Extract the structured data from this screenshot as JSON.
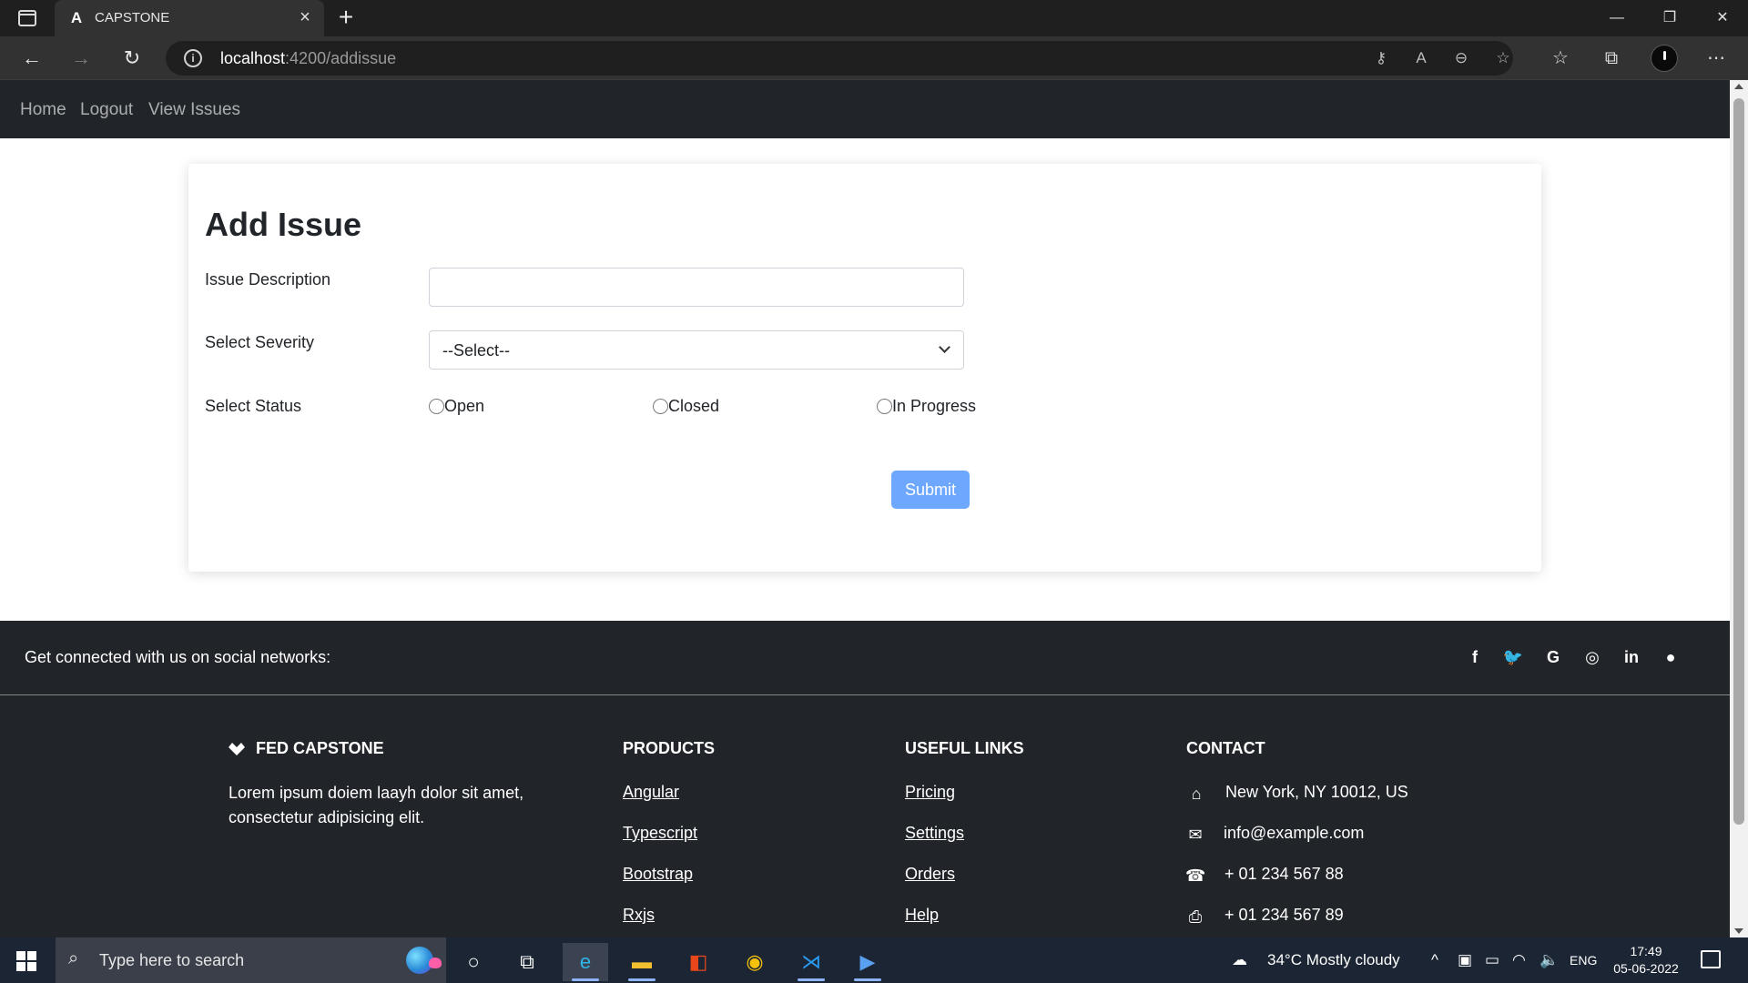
{
  "browser": {
    "tab_title": "CAPSTONE",
    "tab_favicon": "A",
    "url_host": "localhost",
    "url_rest": ":4200/addissue"
  },
  "nav": {
    "items": [
      "Home",
      "Logout",
      "View Issues"
    ]
  },
  "form": {
    "title": "Add Issue",
    "description_label": "Issue Description",
    "description_value": "",
    "severity_label": "Select Severity",
    "severity_selected": "--Select--",
    "status_label": "Select Status",
    "status_options": [
      "Open",
      "Closed",
      "In Progress"
    ],
    "submit_label": "Submit"
  },
  "footer": {
    "social_text": "Get connected with us on social networks:",
    "social_icons": [
      "facebook-icon",
      "twitter-icon",
      "google-icon",
      "instagram-icon",
      "linkedin-icon",
      "github-icon"
    ],
    "brand": "FED CAPSTONE",
    "brand_desc": "Lorem ipsum doiem laayh dolor sit amet, consectetur adipisicing elit.",
    "products_title": "PRODUCTS",
    "products": [
      "Angular",
      "Typescript",
      "Bootstrap",
      "Rxjs"
    ],
    "useful_title": "USEFUL LINKS",
    "useful": [
      "Pricing",
      "Settings",
      "Orders",
      "Help"
    ],
    "contact_title": "CONTACT",
    "contact": [
      "New York, NY 10012, US",
      "info@example.com",
      "+ 01 234 567 88",
      "+ 01 234 567 89"
    ]
  },
  "taskbar": {
    "search_placeholder": "Type here to search",
    "weather": "34°C  Mostly cloudy",
    "language": "ENG",
    "time": "17:49",
    "date": "05-06-2022"
  },
  "colors": {
    "nav_bg": "#212529",
    "submit_bg": "#6ea8fe",
    "taskbar_bg": "#1c2534"
  }
}
